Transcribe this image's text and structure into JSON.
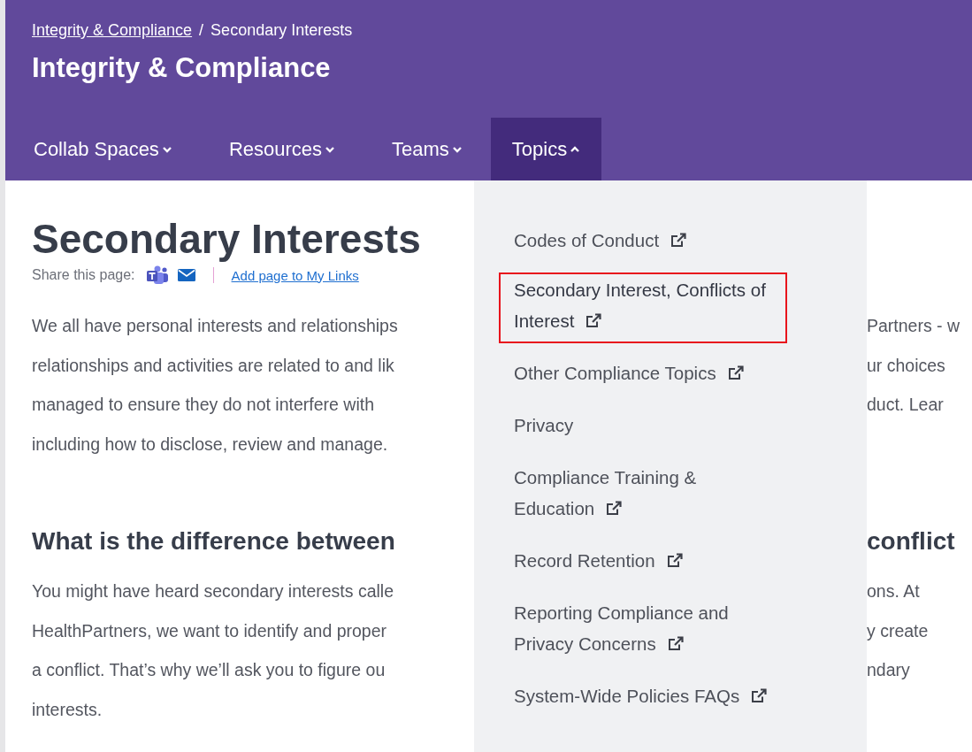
{
  "breadcrumb": [
    {
      "label": "Integrity & Compliance",
      "link": true
    },
    {
      "label": "Secondary Interests",
      "link": false
    }
  ],
  "breadcrumb_separator": "/",
  "site_title": "Integrity & Compliance",
  "nav": [
    {
      "label": "Collab Spaces",
      "expanded": false,
      "selected": false
    },
    {
      "label": "Resources",
      "expanded": false,
      "selected": false
    },
    {
      "label": "Teams",
      "expanded": false,
      "selected": false
    },
    {
      "label": "Topics",
      "expanded": true,
      "selected": true
    }
  ],
  "page_title": "Secondary Interests",
  "share": {
    "label": "Share this page:",
    "link": "Add page to My Links"
  },
  "intro_lines": [
    {
      "left": "We all have personal interests and relationships",
      "right": "Partners - w"
    },
    {
      "left": "relationships and activities are related to and lik",
      "right": "ur choices"
    },
    {
      "left": "managed to ensure they do not interfere with",
      "right": "duct. Lear"
    },
    {
      "left": "including how to disclose, review and manage."
    }
  ],
  "section_heading": {
    "left": "What is the difference between",
    "right": "conflict"
  },
  "section_lines": [
    {
      "left": "You might have heard secondary interests calle",
      "right": "ons. At"
    },
    {
      "left": "HealthPartners, we want to identify and proper",
      "right": "y create"
    },
    {
      "left": "a conflict. That’s why we’ll ask you to figure ou",
      "right": "ndary"
    },
    {
      "left": "interests."
    }
  ],
  "dropdown": [
    {
      "lines": [
        "Codes of Conduct"
      ],
      "external": true,
      "highlighted": false
    },
    {
      "lines": [
        "Secondary Interest, Conflicts of",
        "Interest"
      ],
      "external": true,
      "highlighted": true
    },
    {
      "lines": [
        "Other Compliance Topics"
      ],
      "external": true,
      "highlighted": false
    },
    {
      "lines": [
        "Privacy"
      ],
      "external": false,
      "highlighted": false
    },
    {
      "lines": [
        "Compliance Training &",
        "Education"
      ],
      "external": true,
      "highlighted": false
    },
    {
      "lines": [
        "Record Retention"
      ],
      "external": true,
      "highlighted": false
    },
    {
      "lines": [
        "Reporting Compliance and",
        "Privacy Concerns"
      ],
      "external": true,
      "highlighted": false
    },
    {
      "lines": [
        "System-Wide Policies FAQs"
      ],
      "external": true,
      "highlighted": false
    }
  ]
}
